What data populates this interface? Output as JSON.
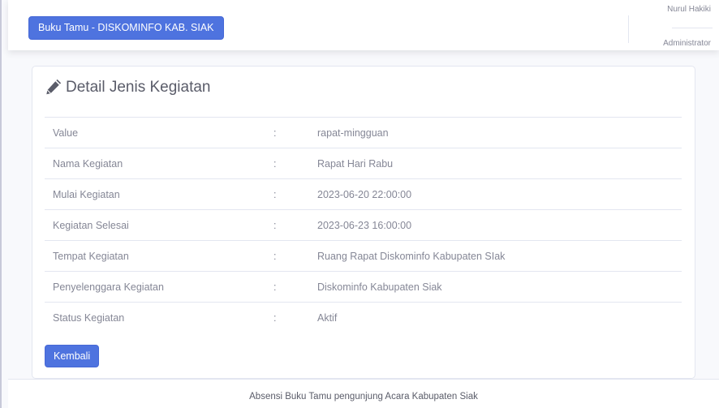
{
  "topbar": {
    "brand": "Buku Tamu - DISKOMINFO KAB. SIAK",
    "user_name": "Nurul Hakiki",
    "user_role": "Administrator"
  },
  "card": {
    "title": "Detail Jenis Kegiatan",
    "title_icon": "pencil-icon",
    "separator": ":",
    "rows": [
      {
        "label": "Value",
        "value": "rapat-mingguan"
      },
      {
        "label": "Nama Kegiatan",
        "value": "Rapat Hari Rabu"
      },
      {
        "label": "Mulai Kegiatan",
        "value": "2023-06-20 22:00:00"
      },
      {
        "label": "Kegiatan Selesai",
        "value": "2023-06-23 16:00:00"
      },
      {
        "label": "Tempat Kegiatan",
        "value": "Ruang Rapat Diskominfo Kabupaten SIak"
      },
      {
        "label": "Penyelenggara Kegiatan",
        "value": "Diskominfo Kabupaten Siak"
      },
      {
        "label": "Status Kegiatan",
        "value": "Aktif"
      }
    ],
    "back_label": "Kembali"
  },
  "footer": {
    "text": "Absensi Buku Tamu pengunjung Acara Kabupaten Siak"
  },
  "colors": {
    "primary": "#4e73df",
    "text": "#858796",
    "heading": "#5a5c69",
    "border": "#e3e6f0",
    "background": "#f8f9fc"
  }
}
